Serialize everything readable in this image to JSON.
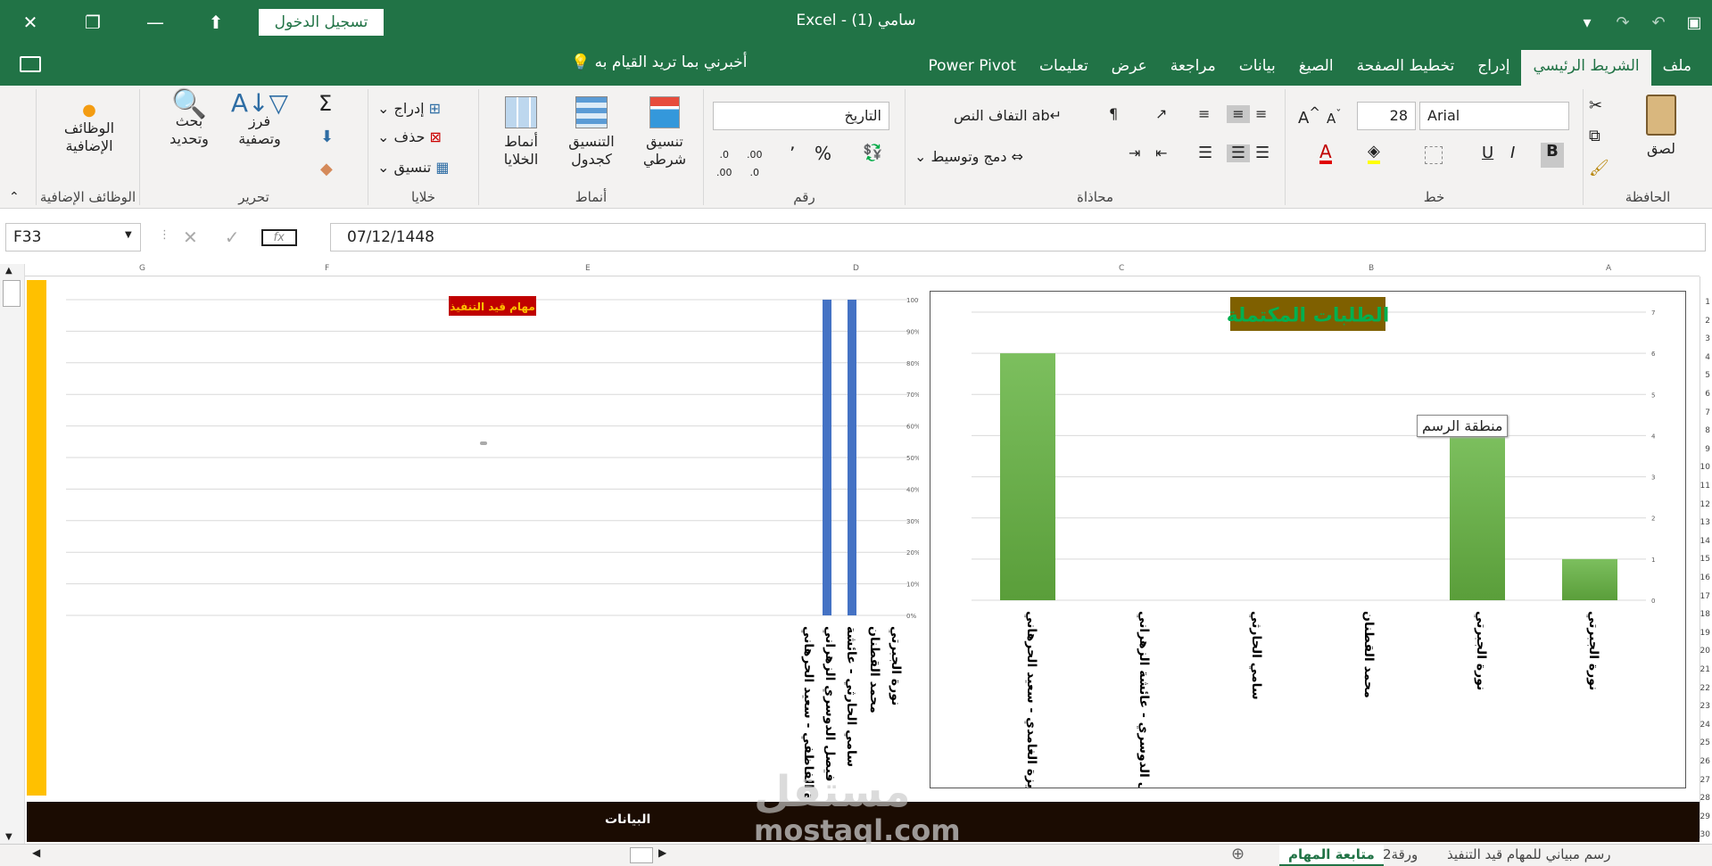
{
  "window": {
    "title": "Excel  -  سامي (1)",
    "sign_in": "تسجيل الدخول"
  },
  "tabs": [
    "ملف",
    "الشريط الرئيسي",
    "إدراج",
    "تخطيط الصفحة",
    "الصيغ",
    "بيانات",
    "مراجعة",
    "عرض",
    "تعليمات",
    "Power Pivot"
  ],
  "tell_me": "أخبرني بما تريد القيام به",
  "ribbon": {
    "clipboard": {
      "label": "الحافظة",
      "paste": "لصق"
    },
    "font": {
      "label": "خط",
      "font_name": "Arial",
      "font_size": "28",
      "bold": "B",
      "italic": "I",
      "underline": "U"
    },
    "alignment": {
      "label": "محاذاة",
      "wrap_text": "التفاف النص",
      "merge_center": "دمج وتوسيط"
    },
    "number": {
      "label": "رقم",
      "format": "التاريخ",
      "percent": "%",
      "comma": "٬",
      "inc_decimal": ".00 ←.0",
      "dec_decimal": ".0 →.00"
    },
    "styles": {
      "label": "أنماط",
      "conditional": "تنسيق شرطي",
      "as_table": "التنسيق كجدول",
      "cell_styles": "أنماط الخلايا"
    },
    "cells": {
      "label": "خلايا",
      "insert": "إدراج",
      "delete": "حذف",
      "format": "تنسيق"
    },
    "editing": {
      "label": "تحرير",
      "sort_filter": "فرز وتصفية",
      "find_select": "بحث وتحديد"
    },
    "addins": {
      "label": "الوظائف الإضافية",
      "addins_btn": "الوظائف الإضافية"
    }
  },
  "formula_bar": {
    "name_box": "F33",
    "formula": "07/12/1448"
  },
  "columns": [
    "G",
    "F",
    "E",
    "D",
    "C",
    "B",
    "A"
  ],
  "rows": [
    "1",
    "2",
    "3",
    "4",
    "5",
    "6",
    "7",
    "8",
    "9",
    "10",
    "11",
    "12",
    "13",
    "14",
    "15",
    "16",
    "17",
    "18",
    "19",
    "20",
    "21",
    "22",
    "23",
    "24",
    "25",
    "26",
    "27",
    "28",
    "29",
    "30"
  ],
  "charts": {
    "plot_area_tooltip": "منطقة الرسم",
    "bottom_bar_label": "البيانات"
  },
  "chart_data": [
    {
      "type": "bar",
      "title": "مهام قيد التنفيذ",
      "categories": [
        "نورة الجبرتي",
        "محمد القطنان",
        "سامي الحارثي - عائشة",
        "فيصل الدوسري الزهراني",
        "عزيزة الفاظفي - سعيد الحرهاني"
      ],
      "values": [
        1,
        1,
        0,
        0,
        0
      ],
      "ylim": [
        0,
        1
      ],
      "y_ticks": [
        "0%",
        "10%",
        "20%",
        "30%",
        "40%",
        "50%",
        "60%",
        "70%",
        "80%",
        "90%",
        "100%"
      ],
      "legend": "none",
      "grid": true,
      "colors": {
        "bar": "#4472c4",
        "title_bg": "#c00000",
        "title_text": "#ffc000"
      }
    },
    {
      "type": "bar",
      "title": "الطلبات المكتملة",
      "categories": [
        "نورة الجبرتي",
        "نورة الجبرتي",
        "محمد القطنان",
        "سامي الحارثي",
        "فيصل الدوسري - عائشة الزهراني",
        "عزيزة الغامدي - سعيد الحرهاني"
      ],
      "values": [
        1,
        4,
        0,
        0,
        0,
        6
      ],
      "ylim": [
        0,
        7
      ],
      "y_ticks": [
        "0",
        "1",
        "2",
        "3",
        "4",
        "5",
        "6",
        "7"
      ],
      "legend": "none",
      "grid": true,
      "colors": {
        "bar": "#70ad47",
        "title_bg": "#7f6000",
        "title_text": "#00b050"
      }
    }
  ],
  "sheets": {
    "active": "متابعة المهام",
    "others": [
      "ورقة2",
      "رسم مبياني للمهام قيد التنفيذ"
    ]
  },
  "watermark": {
    "text1": "مستقل",
    "text2": "mostaql.com"
  },
  "colors": {
    "excel_green": "#217346",
    "ribbon_bg": "#f3f2f1",
    "yellow_strip": "#ffc000",
    "dark_bar": "#1b0c02"
  }
}
